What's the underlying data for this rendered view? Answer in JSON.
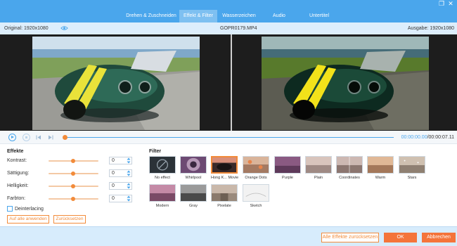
{
  "tabs": [
    {
      "label": "Drehen & Zuschneiden"
    },
    {
      "label": "Effekt & Filter"
    },
    {
      "label": "Wasserzeichen"
    },
    {
      "label": "Audio"
    },
    {
      "label": "Untertitel"
    }
  ],
  "active_tab": "Effekt & Filter",
  "info": {
    "original": "Original: 1920x1080",
    "filename": "GOPR0179.MP4",
    "output": "Ausgabe: 1920x1080"
  },
  "playback": {
    "current": "00:00:00.00",
    "total": "/00:00:07.11"
  },
  "effects": {
    "title": "Effekte",
    "sliders": [
      {
        "label": "Kontrast:",
        "value": "0",
        "level": 0.5
      },
      {
        "label": "Sättigung:",
        "value": "0",
        "level": 0.5
      },
      {
        "label": "Helligkeit:",
        "value": "0",
        "level": 0.5
      },
      {
        "label": "Farbton:",
        "value": "0",
        "level": 0.5
      }
    ],
    "deinterlacing": "Deinterlacing",
    "apply_all": "Auf alle anwenden",
    "reset": "Zurücksetzen"
  },
  "filter": {
    "title": "Filter",
    "items": [
      {
        "label": "No effect"
      },
      {
        "label": "Whirlpool"
      },
      {
        "label": "Hong K... Movie"
      },
      {
        "label": "Orange Dots"
      },
      {
        "label": "Purple"
      },
      {
        "label": "Plain"
      },
      {
        "label": "Coordinates"
      },
      {
        "label": "Warm"
      },
      {
        "label": "Stars"
      },
      {
        "label": "Modern"
      },
      {
        "label": "Gray"
      },
      {
        "label": "Pixelate"
      },
      {
        "label": "Sketch"
      }
    ],
    "selected": "Hong K... Movie"
  },
  "footer": {
    "reset_all": "Alle Effekte zurücksetzen",
    "ok": "OK",
    "cancel": "Abbrechen"
  },
  "colors": {
    "accent": "#4aa6ec",
    "orange": "#f28b3a"
  }
}
